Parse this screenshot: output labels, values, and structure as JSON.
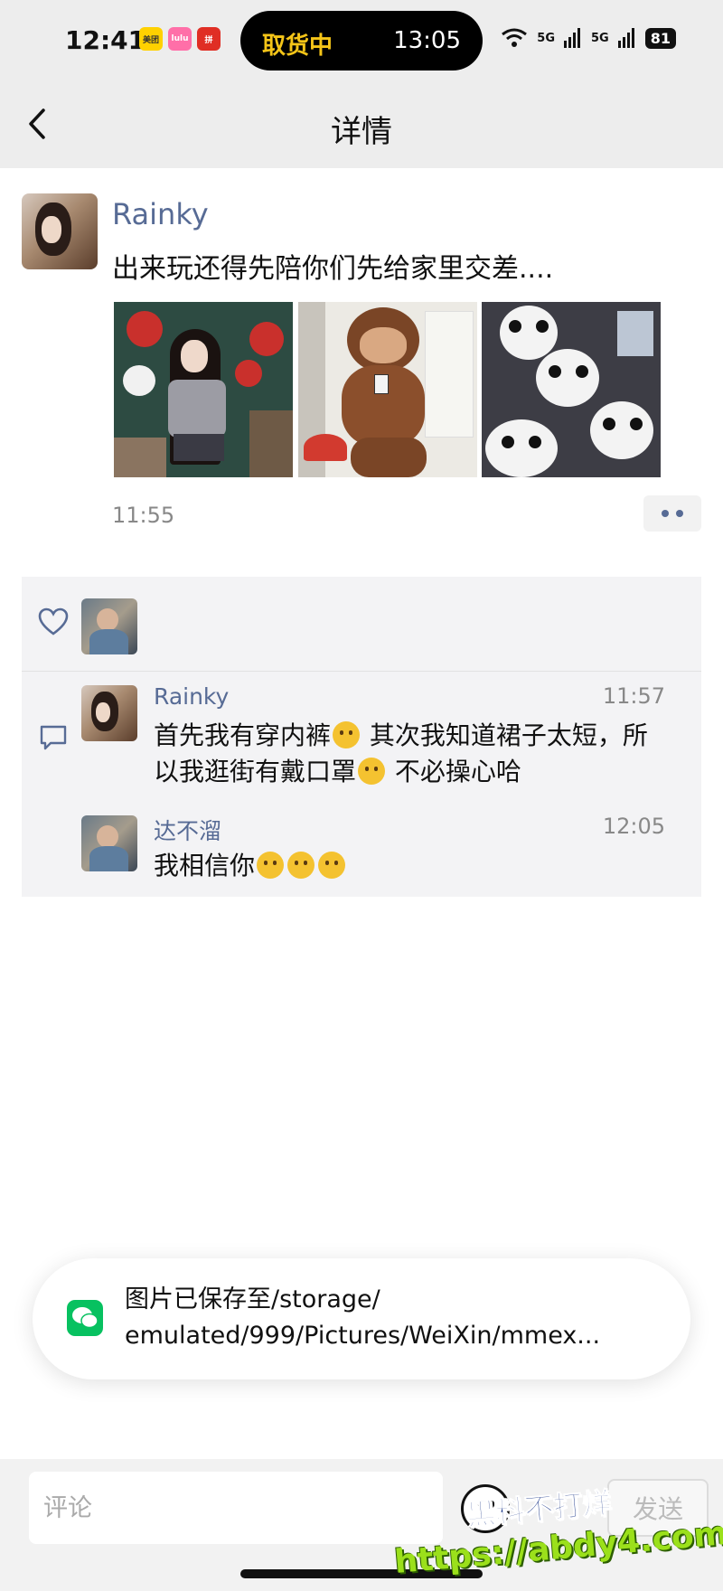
{
  "status_bar": {
    "time": "12:41",
    "apps": [
      "美团",
      "lulu",
      "拼"
    ],
    "pill_left": "取货中",
    "pill_right": "13:05",
    "network1": "5G",
    "network2": "5G",
    "battery": "81"
  },
  "header": {
    "title": "详情"
  },
  "post": {
    "author": "Rainky",
    "text": "出来玩还得先陪你们先给家里交差....",
    "time": "11:55",
    "photos": [
      "photo-1",
      "photo-2",
      "photo-3"
    ]
  },
  "comments": [
    {
      "author": "Rainky",
      "time": "11:57",
      "line1": "首先我有穿内裤",
      "line1b": " 其次我知道裙子太短，所",
      "line2": "以我逛街有戴口罩",
      "line2b": " 不必操心哈"
    },
    {
      "author": "达不溜",
      "time": "12:05",
      "text": "我相信你"
    }
  ],
  "toast": {
    "line1": "图片已保存至/storage/",
    "line2": "emulated/999/Pictures/WeiXin/mmex..."
  },
  "bottom": {
    "placeholder": "评论",
    "send_label": "发送"
  },
  "watermark": {
    "line1": "黑料不打烊",
    "line2": "https://abdy4.com"
  },
  "colors": {
    "link_blue": "#576b95",
    "header_bg": "#ededed",
    "comment_bg": "#f3f3f5",
    "wechat_green": "#07c160"
  }
}
